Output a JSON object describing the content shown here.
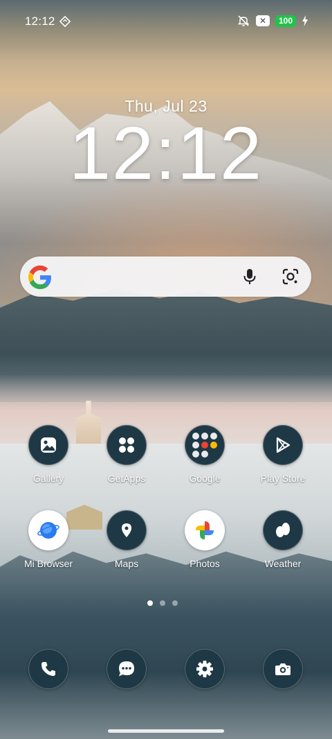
{
  "status_bar": {
    "time": "12:12",
    "battery": "100",
    "icons": [
      "diamond-sync-icon",
      "mute-icon",
      "x-badge-icon",
      "charging-bolt-icon"
    ],
    "x_badge": "✕"
  },
  "clock": {
    "date": "Thu, Jul 23",
    "time": "12:12"
  },
  "search": {
    "placeholder": "",
    "icons": [
      "google-g-icon",
      "microphone-icon",
      "google-lens-icon"
    ]
  },
  "apps": [
    {
      "label": "Gallery",
      "icon": "gallery-icon"
    },
    {
      "label": "GetApps",
      "icon": "getapps-icon"
    },
    {
      "label": "Google",
      "icon": "google-folder-icon"
    },
    {
      "label": "Play Store",
      "icon": "play-store-icon"
    },
    {
      "label": "Mi Browser",
      "icon": "browser-icon"
    },
    {
      "label": "Maps",
      "icon": "maps-icon"
    },
    {
      "label": "Photos",
      "icon": "photos-icon"
    },
    {
      "label": "Weather",
      "icon": "weather-icon"
    }
  ],
  "page_indicator": {
    "pages": 3,
    "active": 1
  },
  "dock": [
    {
      "name": "Phone",
      "icon": "phone-icon"
    },
    {
      "name": "Messages",
      "icon": "messages-icon"
    },
    {
      "name": "Settings",
      "icon": "settings-icon"
    },
    {
      "name": "Camera",
      "icon": "camera-icon"
    }
  ],
  "colors": {
    "icon_background": "#1e3845",
    "battery_green": "#21c24a",
    "search_background": "#f5f5f7"
  }
}
